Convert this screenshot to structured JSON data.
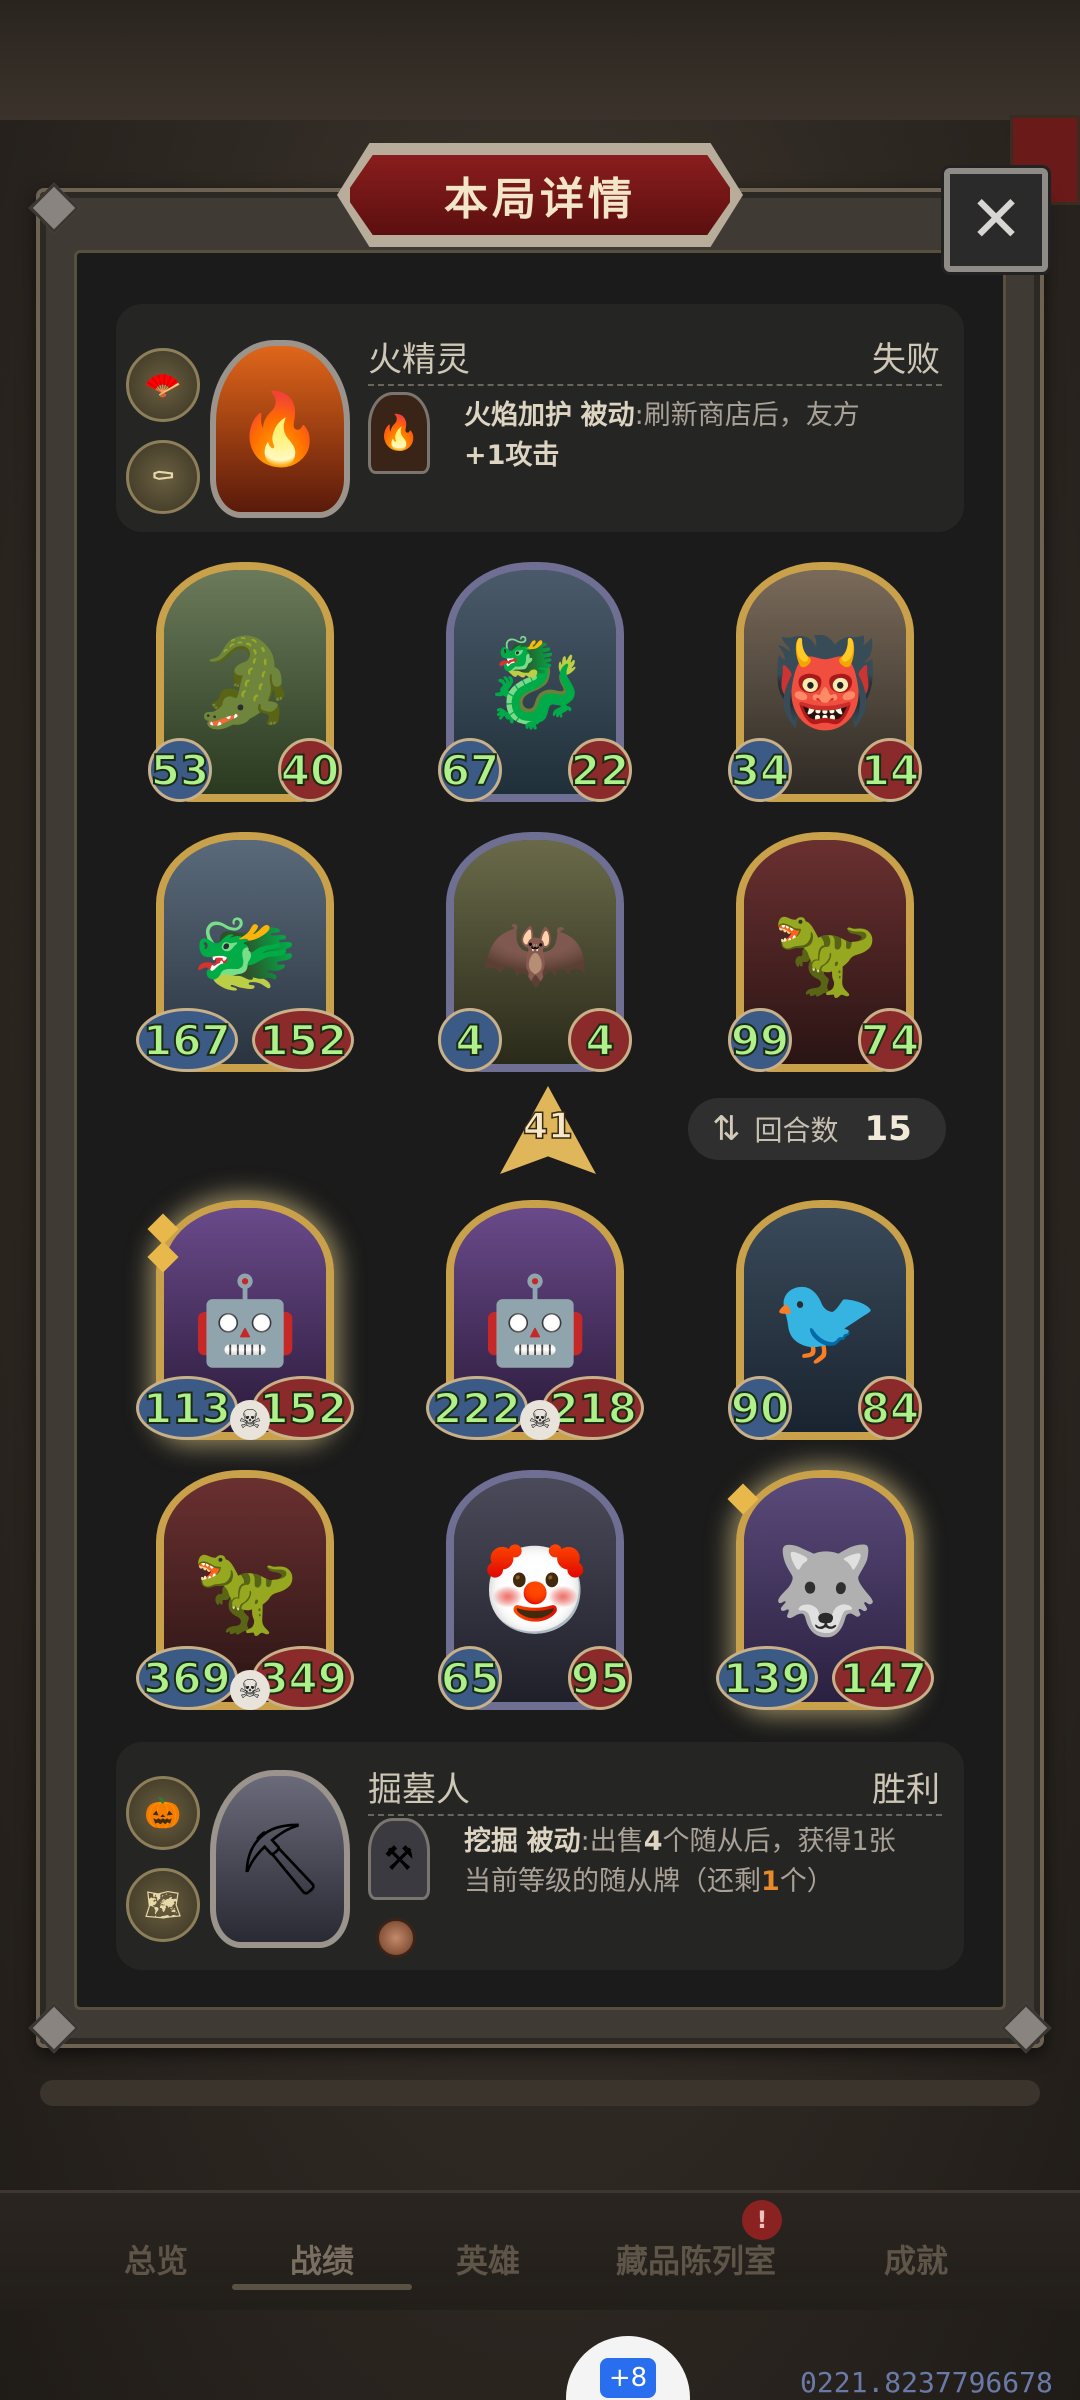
{
  "title": "本局详情",
  "close_label": "✕",
  "top_hero": {
    "name": "火精灵",
    "result": "失败",
    "skill_name": "火焰加护",
    "skill_type": "被动",
    "skill_desc": ":刷新商店后，友方",
    "skill_desc2": "+1攻击",
    "token_icons": [
      "fan-icon",
      "coffin-icon"
    ],
    "portrait_icon": "fire-spirit-icon"
  },
  "bottom_hero": {
    "name": "掘墓人",
    "result": "胜利",
    "skill_name": "挖掘",
    "skill_type": "被动",
    "skill_desc_a": ":出售",
    "skill_desc_b": "4",
    "skill_desc_c": "个随从后，获得1张",
    "skill_desc2_a": "当前等级的随从牌（还剩",
    "skill_desc2_b": "1",
    "skill_desc2_c": "个）",
    "token_icons": [
      "scarecrow-icon",
      "map-icon"
    ],
    "portrait_icon": "gravedigger-icon"
  },
  "enemy_minions": [
    {
      "atk": "53",
      "hp": "40",
      "icon": "crocodile-dragon-icon",
      "frame": "gold"
    },
    {
      "atk": "67",
      "hp": "22",
      "icon": "azure-dragon-icon",
      "frame": "silver"
    },
    {
      "atk": "34",
      "hp": "14",
      "icon": "horned-beast-icon",
      "frame": "gold"
    },
    {
      "atk": "167",
      "hp": "152",
      "icon": "blue-dragon-icon",
      "frame": "gold"
    },
    {
      "atk": "4",
      "hp": "4",
      "icon": "skull-bat-icon",
      "frame": "silver"
    },
    {
      "atk": "99",
      "hp": "74",
      "icon": "red-mech-dragon-icon",
      "frame": "gold"
    }
  ],
  "tier": "41",
  "round": {
    "label": "回合数",
    "value": "15"
  },
  "player_minions": [
    {
      "atk": "113",
      "hp": "152",
      "icon": "robot-octopus-icon",
      "frame": "gold",
      "skull": true,
      "glow": true,
      "stars": 2
    },
    {
      "atk": "222",
      "hp": "218",
      "icon": "robot-octopus-icon",
      "frame": "gold",
      "skull": true
    },
    {
      "atk": "90",
      "hp": "84",
      "icon": "phoenix-icon",
      "frame": "gold"
    },
    {
      "atk": "369",
      "hp": "349",
      "icon": "red-mech-dragon-icon",
      "frame": "gold",
      "skull": true
    },
    {
      "atk": "65",
      "hp": "95",
      "icon": "clown-icon",
      "frame": "silver"
    },
    {
      "atk": "139",
      "hp": "147",
      "icon": "wolf-rogue-icon",
      "frame": "gold",
      "glow": true,
      "stars": 1
    }
  ],
  "nav": {
    "overview": "总览",
    "records": "战绩",
    "heroes": "英雄",
    "collection": "藏品陈列室",
    "achievements": "成就",
    "badge": "!"
  },
  "fab_label": "+8",
  "watermark": "0221.8237796678"
}
